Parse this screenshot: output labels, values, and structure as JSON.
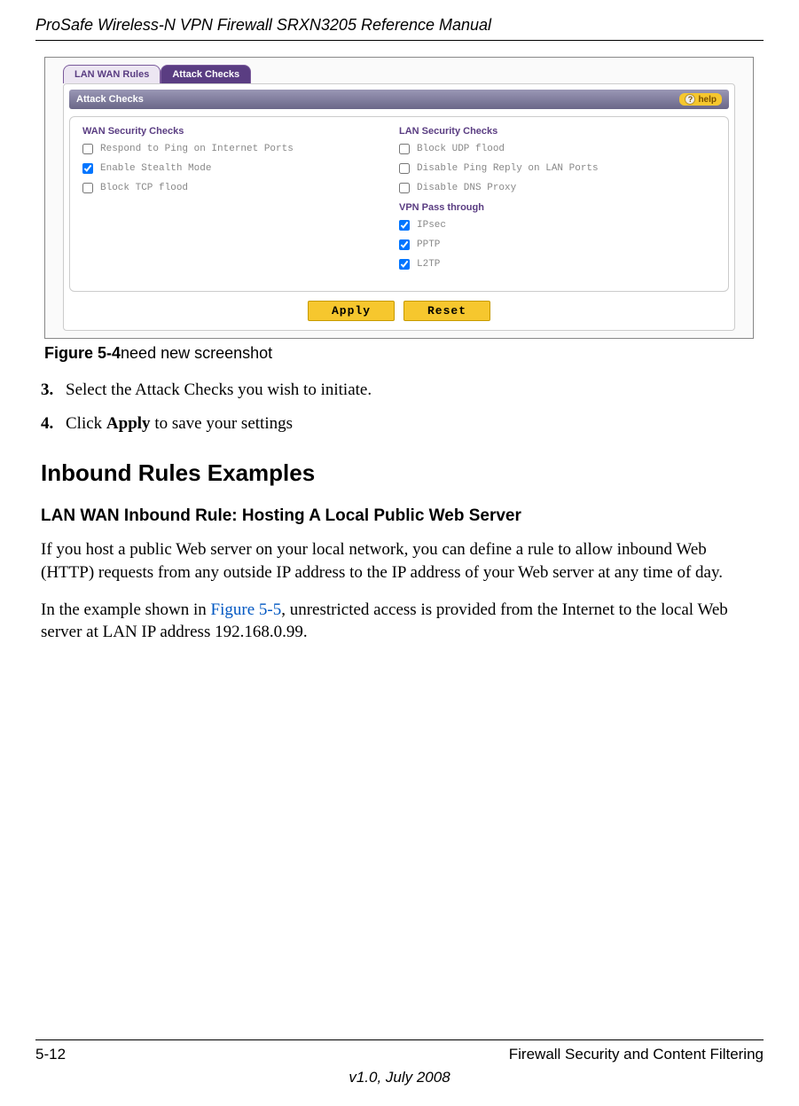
{
  "header": {
    "title": "ProSafe Wireless-N VPN Firewall SRXN3205 Reference Manual"
  },
  "figure": {
    "tabs": {
      "inactive": "LAN WAN Rules",
      "active": "Attack Checks"
    },
    "bar_title": "Attack Checks",
    "help": "help",
    "wan_heading": "WAN Security Checks",
    "wan_opts": [
      {
        "label": "Respond to Ping on Internet Ports",
        "checked": false
      },
      {
        "label": "Enable Stealth Mode",
        "checked": true
      },
      {
        "label": "Block TCP flood",
        "checked": false
      }
    ],
    "lan_heading": "LAN Security Checks",
    "lan_opts": [
      {
        "label": "Block UDP flood",
        "checked": false
      },
      {
        "label": "Disable Ping Reply on LAN Ports",
        "checked": false
      },
      {
        "label": "Disable DNS Proxy",
        "checked": false
      }
    ],
    "vpn_heading": "VPN Pass through",
    "vpn_opts": [
      {
        "label": "IPsec",
        "checked": true
      },
      {
        "label": "PPTP",
        "checked": true
      },
      {
        "label": "L2TP",
        "checked": true
      }
    ],
    "apply": "Apply",
    "reset": "Reset",
    "caption_bold": "Figure 5-4",
    "caption_rest": "need new screenshot"
  },
  "steps": {
    "s3_num": "3.",
    "s3_text": "Select the Attack Checks you wish to initiate.",
    "s4_num": "4.",
    "s4_text_a": "Click ",
    "s4_text_b": "Apply",
    "s4_text_c": " to save your settings"
  },
  "h1": "Inbound Rules Examples",
  "h2": "LAN WAN Inbound Rule: Hosting A Local Public Web Server",
  "p1": "If you host a public Web server on your local network, you can define a rule to allow inbound Web (HTTP) requests from any outside IP address to the IP address of your Web server at any time of day.",
  "p2_a": "In the example shown in ",
  "p2_link": "Figure 5-5",
  "p2_b": ", unrestricted access is provided from the Internet to the local Web server at LAN IP address 192.168.0.99.",
  "footer": {
    "page": "5-12",
    "section": "Firewall Security and Content Filtering",
    "version": "v1.0, July 2008"
  }
}
